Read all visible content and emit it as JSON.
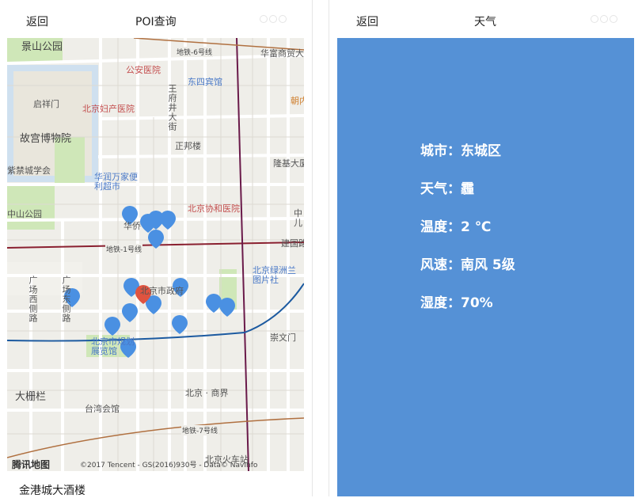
{
  "left_screen": {
    "back_label": "返回",
    "title": "POI查询",
    "poi_name": "金港城大酒楼",
    "map": {
      "logo_text": "腾讯地图",
      "copyright": "©2017 Tencent - GS(2016)930号 - Data© NavInfo",
      "labels": {
        "jingshan_park": "景山公园",
        "gongan_hospital": "公安医院",
        "qixiangmen": "启祥门",
        "beijing_fuchan_hospital": "北京妇产医院",
        "palace_museum": "故宫博物院",
        "zijincheng_society": "紫禁城学会",
        "zhongshan_park": "中山公园",
        "huarun_wanjia": "华润万家便利超市",
        "dongsi_hotel": "东四宾馆",
        "wangfujing_street": "王府井大街",
        "zhengbang_building": "正邦楼",
        "longji_building": "隆基大厦",
        "xiehe_hospital": "北京协和医院",
        "huaqiao_partial": "华侨",
        "jianguo_road": "建国路",
        "subway_line1": "地铁-1号线",
        "subway_line6": "地铁-6号线",
        "subway_line7": "地铁-7号线",
        "huafu_trade": "华富商贸大厦",
        "chaonei_partial": "朝内",
        "guangxi_lane": "广场西侧路",
        "guangdong_lane": "广场东侧路",
        "city_gov": "北京市政府",
        "green_island": "北京绿洲兰图片社",
        "exhibition_hall": "北京市规划展览馆",
        "chongwenmen": "崇文门",
        "dashilan": "大栅栏",
        "taiwan_hall": "台湾会馆",
        "beijing_commercial": "北京 · 商界",
        "beijing_xizhan": "北京火车站",
        "zhong_partial": "中儿"
      }
    }
  },
  "right_screen": {
    "back_label": "返回",
    "title": "天气",
    "weather": {
      "city": "城市：东城区",
      "condition": "天气：霾",
      "temperature": "温度：2 ℃",
      "wind": "风速：南风 5级",
      "humidity": "湿度：70%"
    },
    "panel_color": "#5591d6"
  },
  "colors": {
    "marker_blue": "#4a90e2",
    "marker_selected": "#e0533f",
    "subway_red": "#a0282e",
    "subway_blue": "#1c5aa0"
  }
}
